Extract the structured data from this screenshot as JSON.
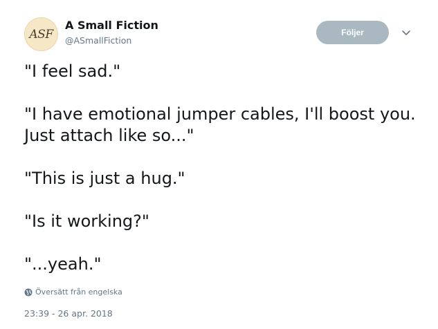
{
  "author": {
    "avatar_text": "ASF",
    "display_name": "A Small Fiction",
    "handle": "@ASmallFiction"
  },
  "follow_label": "Följer",
  "tweet": {
    "lines": [
      "\"I feel sad.\"",
      "\"I have emotional jumper cables, I'll boost you. Just attach like so...\"",
      "\"This is just a hug.\"",
      "\"Is it working?\"",
      "\"...yeah.\""
    ],
    "translate_label": "Översätt från engelska",
    "timestamp": "23:39 - 26 apr. 2018"
  },
  "colors": {
    "follow_button_bg": "#aab8c2",
    "secondary_text": "#657786",
    "primary_text": "#14171a",
    "avatar_bg": "#f6e7c6"
  },
  "icons": {
    "menu": "chevron-down-icon",
    "translate": "globe-icon"
  }
}
